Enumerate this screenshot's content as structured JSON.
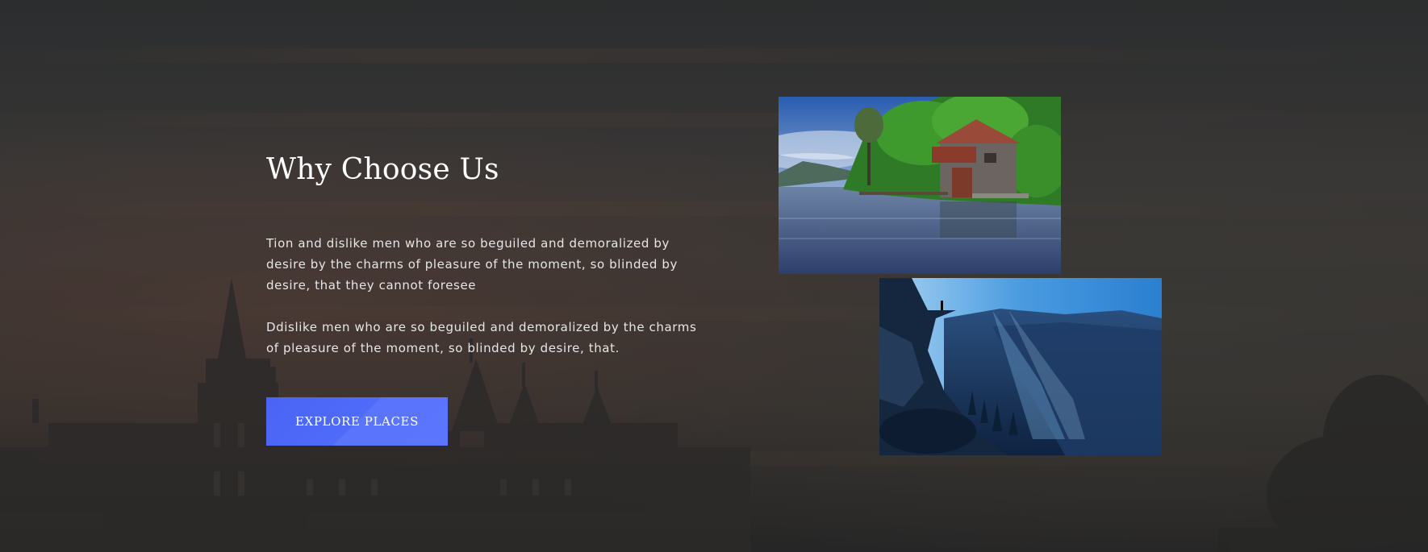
{
  "section": {
    "title": "Why Choose Us",
    "paragraphs": [
      "Tion and dislike men who are so beguiled and demoralized by desire by the charms of pleasure of the moment, so blinded by desire, that they cannot foresee",
      "Ddislike men who are so beguiled and demoralized by the charms of pleasure of the moment, so blinded by desire, that."
    ],
    "cta_label": "EXPLORE PLACES"
  },
  "colors": {
    "button": "#4f6bf8",
    "overlay": "#2f3133",
    "text": "#ffffff"
  },
  "images": [
    {
      "name": "lake-boathouse-photo"
    },
    {
      "name": "mountain-cliff-photo"
    }
  ]
}
